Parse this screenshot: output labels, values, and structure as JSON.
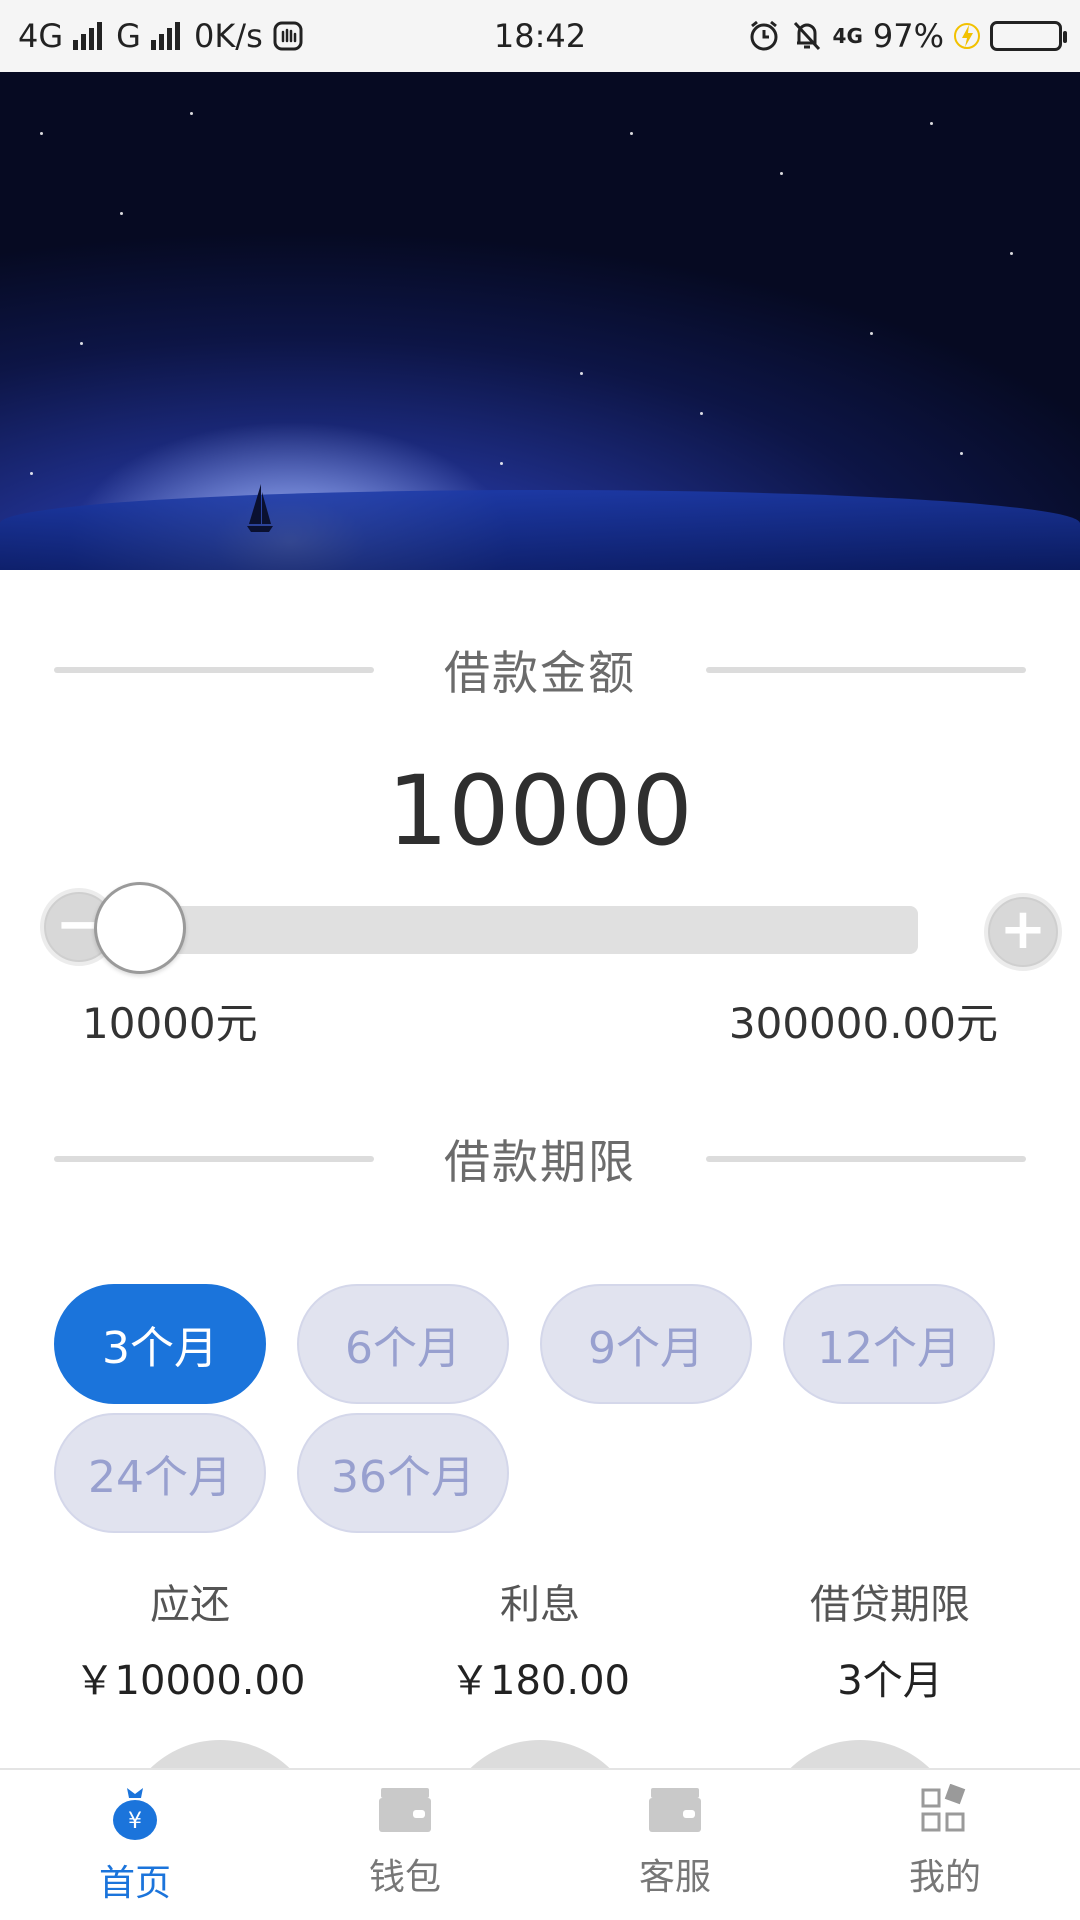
{
  "status_bar": {
    "network_left": "4G",
    "network_g": "G",
    "speed": "0K/s",
    "time": "18:42",
    "network_right": "4G",
    "battery": "97%"
  },
  "loan_amount": {
    "section_title": "借款金额",
    "amount": "10000",
    "min_label": "10000元",
    "max_label": "300000.00元",
    "slider_fraction": 0
  },
  "loan_term": {
    "section_title": "借款期限",
    "options": [
      "3个月",
      "6个月",
      "9个月",
      "12个月",
      "24个月",
      "36个月"
    ],
    "selected": "3个月"
  },
  "summary": {
    "repay_label": "应还",
    "repay_value": "￥10000.00",
    "interest_label": "利息",
    "interest_value": "￥180.00",
    "term_label": "借贷期限",
    "term_value": "3个月"
  },
  "bottom_nav": {
    "items": [
      {
        "label": "首页",
        "icon": "money-bag-icon"
      },
      {
        "label": "钱包",
        "icon": "wallet-icon"
      },
      {
        "label": "客服",
        "icon": "wallet-icon"
      },
      {
        "label": "我的",
        "icon": "grid-icon"
      }
    ],
    "active_index": 0
  },
  "colors": {
    "accent": "#1b74db",
    "chip_inactive_bg": "#e1e3ef",
    "chip_inactive_text": "#98a0cf",
    "battery": "#2ccf3f"
  }
}
